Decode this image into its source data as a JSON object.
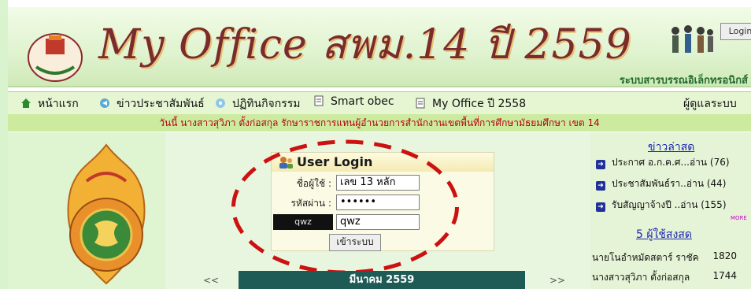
{
  "header": {
    "title": "My Office สพม.14 ปี 2559",
    "subtitle": "ระบบสารบรรณอิเล็กทรอนิกส์",
    "login_label": "Login"
  },
  "nav": {
    "items": [
      {
        "label": "หน้าแรก",
        "icon": "home-icon"
      },
      {
        "label": "ข่าวประชาสัมพันธ์",
        "icon": "news-icon"
      },
      {
        "label": "ปฏิทินกิจกรรม",
        "icon": "calendar-icon"
      },
      {
        "label": "Smart obec",
        "icon": "document-icon"
      },
      {
        "label": "My Office ปี 2558",
        "icon": "document-icon"
      }
    ],
    "admin_label": "ผู้ดูแลระบบ"
  },
  "ticker": "วันนี้ นางสาวสุวิภา ตั้งก่อสกุล รักษาราชการแทนผู้อำนวยการสำนักงานเขตพื้นที่การศึกษามัธยมศึกษา เขต 14",
  "login": {
    "title": "User Login",
    "username_label": "ชื่อผู้ใช้ :",
    "username_value": "เลข 13 หลัก",
    "password_label": "รหัสผ่าน :",
    "password_value": "••••••",
    "captcha_text": "qwz",
    "captcha_value": "qwz",
    "submit_label": "เข้าระบบ"
  },
  "calendar": {
    "prev": "<<",
    "next": ">>",
    "month": "มีนาคม 2559"
  },
  "news": {
    "title": "ข่าวล่าสด",
    "items": [
      "ประกาศ อ.ก.ค.ศ...อ่าน (76)",
      "ประชาสัมพันธ์รา..อ่าน (44)",
      "รับสัญญาจ้างปี ..อ่าน (155)"
    ],
    "more": "MORE"
  },
  "posters": {
    "title": "5 ผู้ใช้สงสด",
    "rows": [
      {
        "name": "นายโนอำหมัดสตาร์ ราชัค",
        "count": "1820"
      },
      {
        "name": "นางสาวสุวิภา ตั้งก่อสกุล",
        "count": "1744"
      }
    ]
  },
  "colors": {
    "ticker_text": "#b3000f",
    "nav_bg": "#e6f6d3",
    "calendar_header": "#1f5b56",
    "highlight_ellipse": "#cc1111"
  }
}
